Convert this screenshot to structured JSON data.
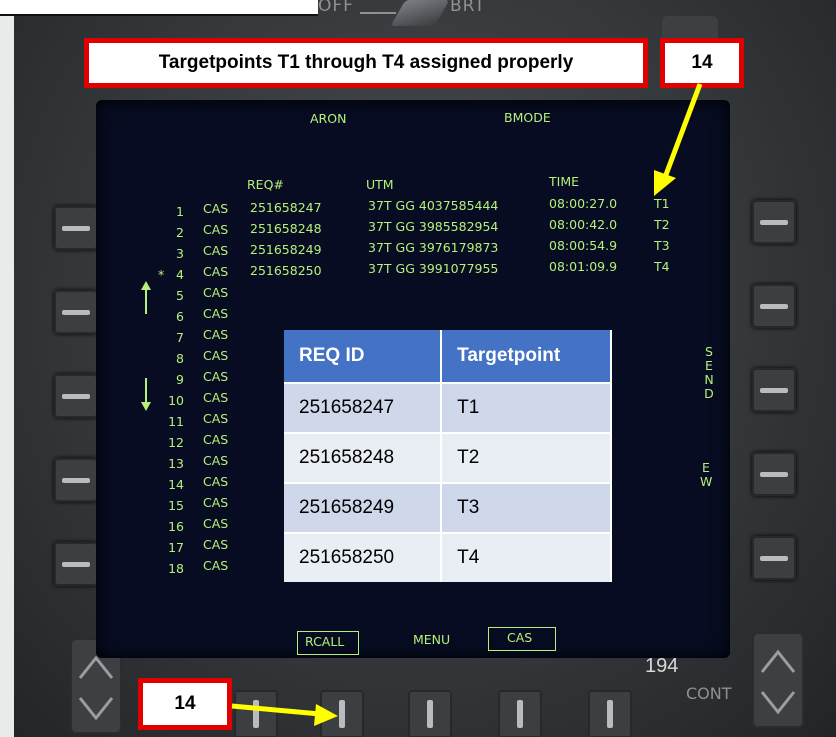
{
  "brightness_control": {
    "off_label": "OFF",
    "brt_label": "BRT"
  },
  "callout": {
    "text": "Targetpoints T1 through T4 assigned properly",
    "step_top": "14",
    "step_bottom": "14",
    "accent_color": "#e00000",
    "arrow_color": "#ffff00"
  },
  "mfd": {
    "top_labels": {
      "left": "ARON",
      "right": "BMODE"
    },
    "headers": {
      "req": "REQ#",
      "utm": "UTM",
      "time": "TIME"
    },
    "rows": [
      {
        "num": "1",
        "type": "CAS",
        "req": "251658247",
        "utm": "37T GG 4037585444",
        "time": "08:00:27.0",
        "tp": "T1"
      },
      {
        "num": "2",
        "type": "CAS",
        "req": "251658248",
        "utm": "37T GG 3985582954",
        "time": "08:00:42.0",
        "tp": "T2"
      },
      {
        "num": "3",
        "type": "CAS",
        "req": "251658249",
        "utm": "37T GG 3976179873",
        "time": "08:00:54.9",
        "tp": "T3"
      },
      {
        "num": "4",
        "type": "CAS",
        "req": "251658250",
        "utm": "37T GG 3991077955",
        "time": "08:01:09.9",
        "tp": "T4",
        "selected_marker": "*"
      },
      {
        "num": "5",
        "type": "CAS"
      },
      {
        "num": "6",
        "type": "CAS"
      },
      {
        "num": "7",
        "type": "CAS"
      },
      {
        "num": "8",
        "type": "CAS"
      },
      {
        "num": "9",
        "type": "CAS"
      },
      {
        "num": "10",
        "type": "CAS"
      },
      {
        "num": "11",
        "type": "CAS"
      },
      {
        "num": "12",
        "type": "CAS"
      },
      {
        "num": "13",
        "type": "CAS"
      },
      {
        "num": "14",
        "type": "CAS"
      },
      {
        "num": "15",
        "type": "CAS"
      },
      {
        "num": "16",
        "type": "CAS"
      },
      {
        "num": "17",
        "type": "CAS"
      },
      {
        "num": "18",
        "type": "CAS"
      }
    ],
    "right_labels": {
      "send": "SEND",
      "ew": "EW"
    },
    "bottom_labels": {
      "rcall": "RCALL",
      "menu": "MENU",
      "cas": "CAS"
    },
    "text_color": "#b5f07a"
  },
  "overlay_table": {
    "headers": [
      "REQ ID",
      "Targetpoint"
    ],
    "rows": [
      [
        "251658247",
        "T1"
      ],
      [
        "251658248",
        "T2"
      ],
      [
        "251658249",
        "T3"
      ],
      [
        "251658250",
        "T4"
      ]
    ],
    "header_color": "#4472c4"
  },
  "page_number": "194",
  "cont_label": "CONT",
  "icons": {
    "scroll_up": "arrow-up-icon",
    "scroll_down": "arrow-down-icon",
    "rocker_up": "chevron-up-icon",
    "rocker_down": "chevron-down-icon"
  }
}
